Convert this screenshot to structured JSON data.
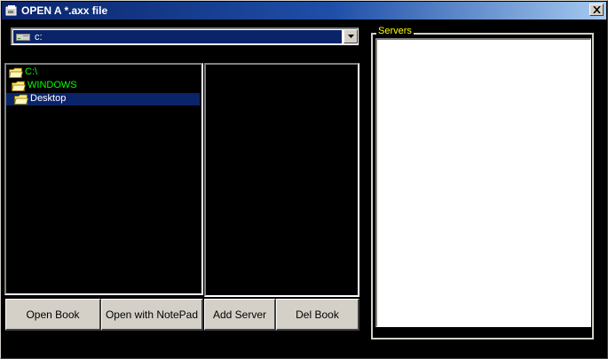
{
  "window": {
    "title": "OPEN A *.axx file",
    "icon": "app-icon",
    "close_icon": "close-icon"
  },
  "drive": {
    "selected": "c:",
    "icon": "drive-icon"
  },
  "directories": [
    {
      "label": "C:\\",
      "state": "normal"
    },
    {
      "label": "WINDOWS",
      "state": "normal"
    },
    {
      "label": "Desktop",
      "state": "selected"
    }
  ],
  "files": [],
  "buttons": {
    "open_book": "Open Book",
    "open_notepad": "Open with NotePad",
    "add_server": "Add Server",
    "del_book": "Del Book"
  },
  "servers": {
    "legend": "Servers",
    "items": []
  },
  "colors": {
    "titlebar": "#0a246a",
    "selection": "#0a246a",
    "folder_text": "#00ff00",
    "legend_text": "#ffff00"
  }
}
